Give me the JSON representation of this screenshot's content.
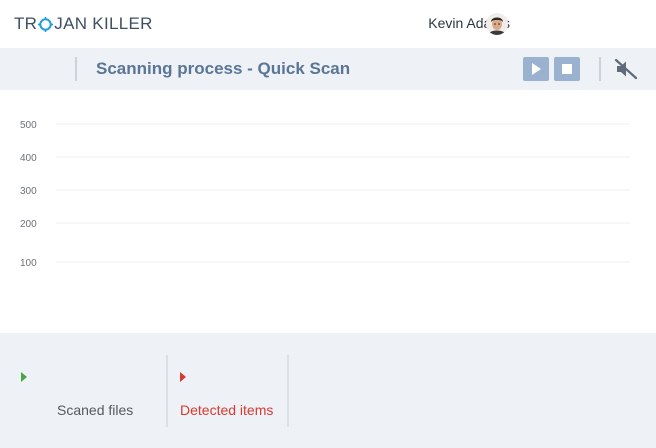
{
  "app": {
    "logo_left": "TR",
    "logo_right": "JAN KILLER",
    "logo_icon": "crosshair-o-icon"
  },
  "user": {
    "name": "Kevin Adams",
    "avatar_icon": "user-avatar-icon"
  },
  "toolbar": {
    "title": "Scanning process - Quick Scan",
    "play_icon": "play-icon",
    "stop_icon": "stop-icon",
    "mute_icon": "speaker-muted-icon",
    "accent_color": "#9ab2cf",
    "title_color": "#5b7597"
  },
  "chart_data": {
    "type": "line",
    "title": "",
    "xlabel": "",
    "ylabel": "",
    "y_ticks": [
      "500",
      "400",
      "300",
      "200",
      "100"
    ],
    "ylim": [
      0,
      500
    ],
    "grid": true,
    "series": []
  },
  "stats": {
    "scanned": {
      "label": "Scaned files",
      "value": "",
      "color": "#49a648"
    },
    "detected": {
      "label": "Detected items",
      "value": "",
      "color": "#d9392f"
    }
  }
}
